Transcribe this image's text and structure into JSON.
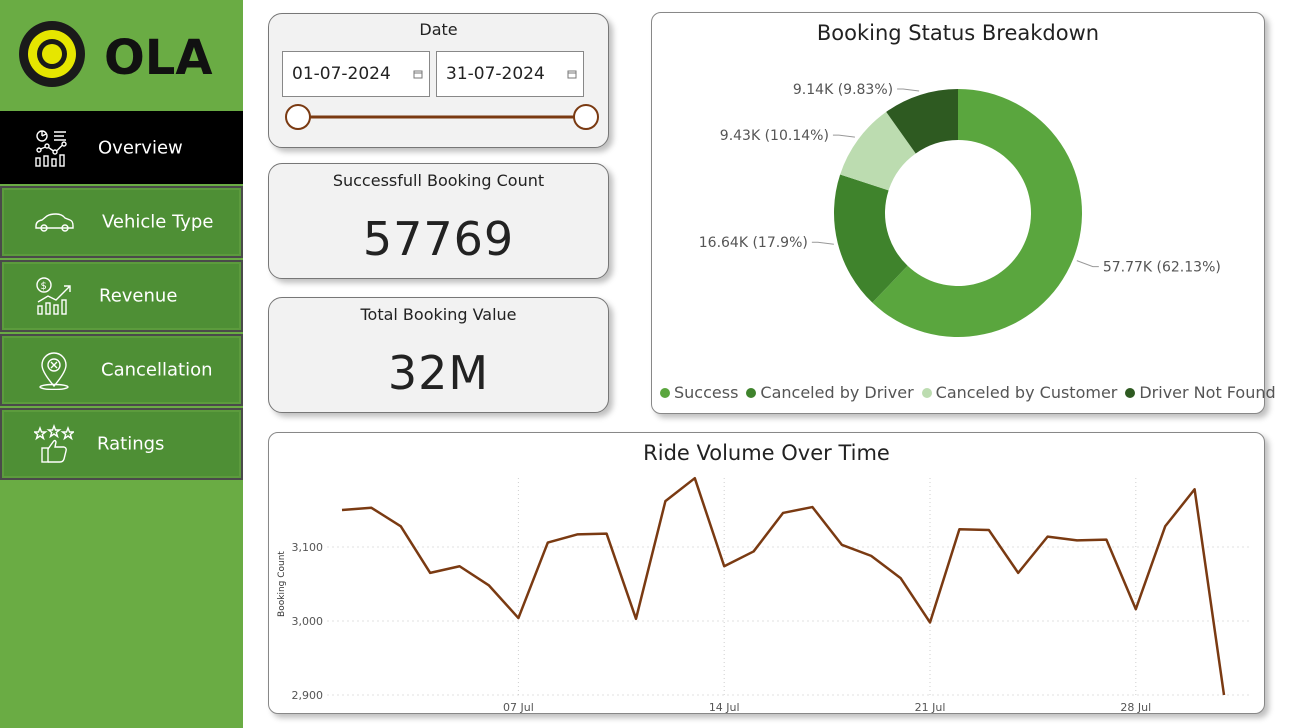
{
  "brand": {
    "name": "OLA"
  },
  "sidebar": {
    "items": [
      {
        "label": "Overview",
        "icon": "dashboard-analytics-icon",
        "active": true
      },
      {
        "label": "Vehicle Type",
        "icon": "car-icon",
        "active": false
      },
      {
        "label": "Revenue",
        "icon": "revenue-growth-icon",
        "active": false
      },
      {
        "label": "Cancellation",
        "icon": "location-cancel-icon",
        "active": false
      },
      {
        "label": "Ratings",
        "icon": "thumbs-up-stars-icon",
        "active": false
      }
    ]
  },
  "date_filter": {
    "title": "Date",
    "start": "01-07-2024",
    "end": "31-07-2024",
    "slider_start": 0,
    "slider_end": 1
  },
  "kpis": {
    "success_title": "Successfull Booking Count",
    "success_value": "57769",
    "value_title": "Total Booking Value",
    "value_value": "32M"
  },
  "colors": {
    "sidebar_bg": "#6aac44",
    "nav_active": "#000000",
    "nav_inactive": "#4e8f35",
    "line": "#7a3a12",
    "success": "#5aa63e",
    "canceled_driver": "#3f832c",
    "canceled_customer": "#bcdcb0",
    "driver_not_found": "#2e5a21"
  },
  "chart_data": [
    {
      "type": "pie",
      "title": "Booking Status Breakdown",
      "categories": [
        "Success",
        "Canceled by Driver",
        "Canceled by Customer",
        "Driver Not Found"
      ],
      "values": [
        57.77,
        16.64,
        9.43,
        9.14
      ],
      "labels": [
        "57.77K (62.13%)",
        "16.64K (17.9%)",
        "9.43K (10.14%)",
        "9.14K (9.83%)"
      ],
      "legend": "bottom"
    },
    {
      "type": "line",
      "title": "Ride Volume Over Time",
      "ylabel": "Booking Count",
      "ylim": [
        2900,
        3200
      ],
      "y_ticks": [
        "2,900",
        "3,000",
        "3,100"
      ],
      "x_ticks": [
        "07 Jul",
        "14 Jul",
        "21 Jul",
        "28 Jul"
      ],
      "x": [
        1,
        2,
        3,
        4,
        5,
        6,
        7,
        8,
        9,
        10,
        11,
        12,
        13,
        14,
        15,
        16,
        17,
        18,
        19,
        20,
        21,
        22,
        23,
        24,
        25,
        26,
        27,
        28,
        29,
        30,
        31
      ],
      "values": [
        3150,
        3153,
        3128,
        3065,
        3074,
        3048,
        3004,
        3106,
        3117,
        3118,
        3003,
        3162,
        3193,
        3074,
        3094,
        3146,
        3154,
        3103,
        3088,
        3058,
        2998,
        3124,
        3123,
        3065,
        3114,
        3109,
        3110,
        3016,
        3128,
        3178,
        2900
      ],
      "grid": true
    }
  ]
}
